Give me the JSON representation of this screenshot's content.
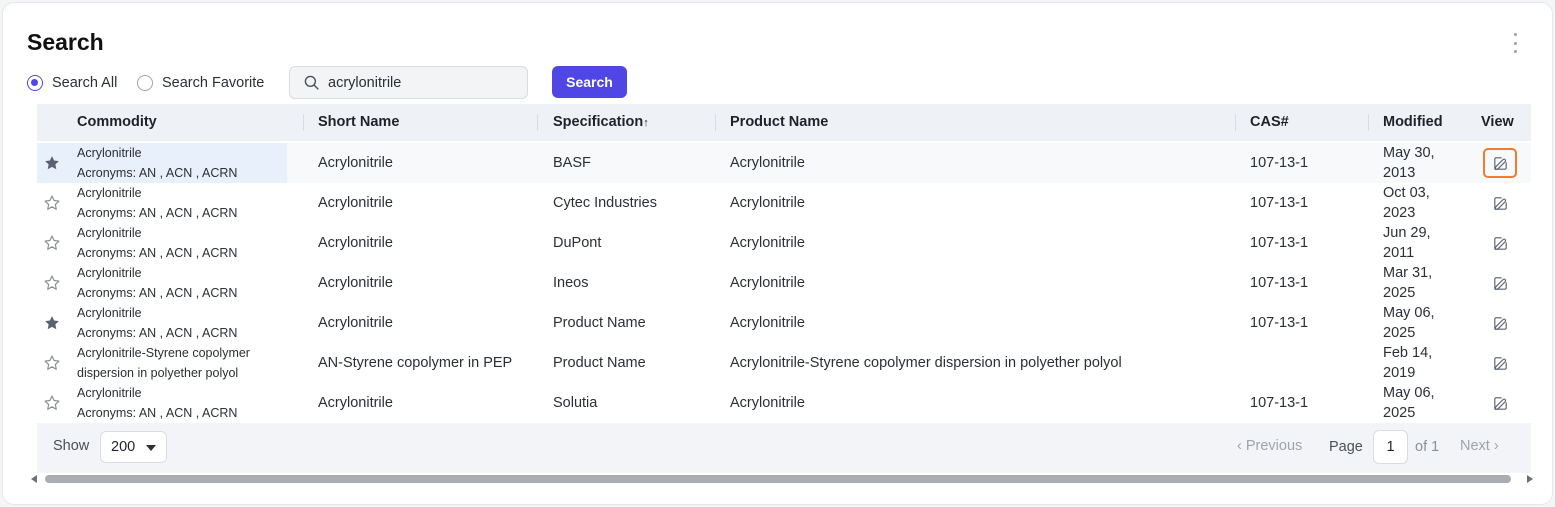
{
  "page": {
    "title": "Search"
  },
  "filters": {
    "search_all": "Search All",
    "search_favorite": "Search Favorite",
    "selected": "search_all"
  },
  "search": {
    "value": "acrylonitrile",
    "button": "Search"
  },
  "table": {
    "columns": {
      "commodity": "Commodity",
      "short_name": "Short Name",
      "specification": "Specification",
      "sort_arrow": "↑",
      "product_name": "Product Name",
      "cas": "CAS#",
      "modified": "Modified",
      "view": "View"
    },
    "rows": [
      {
        "favorite": true,
        "commodity": "Acrylonitrile",
        "acronyms": "Acronyms: AN , ACN , ACRN",
        "short_name": "Acrylonitrile",
        "specification": "BASF",
        "product_name": "Acrylonitrile",
        "cas": "107-13-1",
        "modified_1": "May 30,",
        "modified_2": "2013"
      },
      {
        "favorite": false,
        "commodity": "Acrylonitrile",
        "acronyms": "Acronyms: AN , ACN , ACRN",
        "short_name": "Acrylonitrile",
        "specification": "Cytec Industries",
        "product_name": "Acrylonitrile",
        "cas": "107-13-1",
        "modified_1": "Oct 03,",
        "modified_2": "2023"
      },
      {
        "favorite": false,
        "commodity": "Acrylonitrile",
        "acronyms": "Acronyms: AN , ACN , ACRN",
        "short_name": "Acrylonitrile",
        "specification": "DuPont",
        "product_name": "Acrylonitrile",
        "cas": "107-13-1",
        "modified_1": "Jun 29,",
        "modified_2": "2011"
      },
      {
        "favorite": false,
        "commodity": "Acrylonitrile",
        "acronyms": "Acronyms: AN , ACN , ACRN",
        "short_name": "Acrylonitrile",
        "specification": "Ineos",
        "product_name": "Acrylonitrile",
        "cas": "107-13-1",
        "modified_1": "Mar 31,",
        "modified_2": "2025"
      },
      {
        "favorite": true,
        "commodity": "Acrylonitrile",
        "acronyms": "Acronyms: AN , ACN , ACRN",
        "short_name": "Acrylonitrile",
        "specification": "Product Name",
        "product_name": "Acrylonitrile",
        "cas": "107-13-1",
        "modified_1": "May 06,",
        "modified_2": "2025"
      },
      {
        "favorite": false,
        "commodity": "Acrylonitrile-Styrene copolymer",
        "acronyms": "dispersion in polyether polyol",
        "short_name": "AN-Styrene copolymer in PEP",
        "specification": "Product Name",
        "product_name": "Acrylonitrile-Styrene copolymer dispersion in polyether polyol",
        "cas": "",
        "modified_1": "Feb 14,",
        "modified_2": "2019"
      },
      {
        "favorite": false,
        "commodity": "Acrylonitrile",
        "acronyms": "Acronyms: AN , ACN , ACRN",
        "short_name": "Acrylonitrile",
        "specification": "Solutia",
        "product_name": "Acrylonitrile",
        "cas": "107-13-1",
        "modified_1": "May 06,",
        "modified_2": "2025"
      }
    ]
  },
  "pagination": {
    "show_label": "Show",
    "page_size": "200",
    "previous": "‹ Previous",
    "page_label": "Page",
    "page": "1",
    "of": "of 1",
    "next": "Next ›"
  },
  "colors": {
    "accent": "#4f46e5",
    "focus_outline": "#f07c2e",
    "highlight": "#e8f1fb"
  },
  "icons": {
    "search": "search-icon",
    "star_filled": "star-filled-icon",
    "star_outline": "star-outline-icon",
    "edit": "edit-icon",
    "menu": "kebab-menu-icon"
  }
}
